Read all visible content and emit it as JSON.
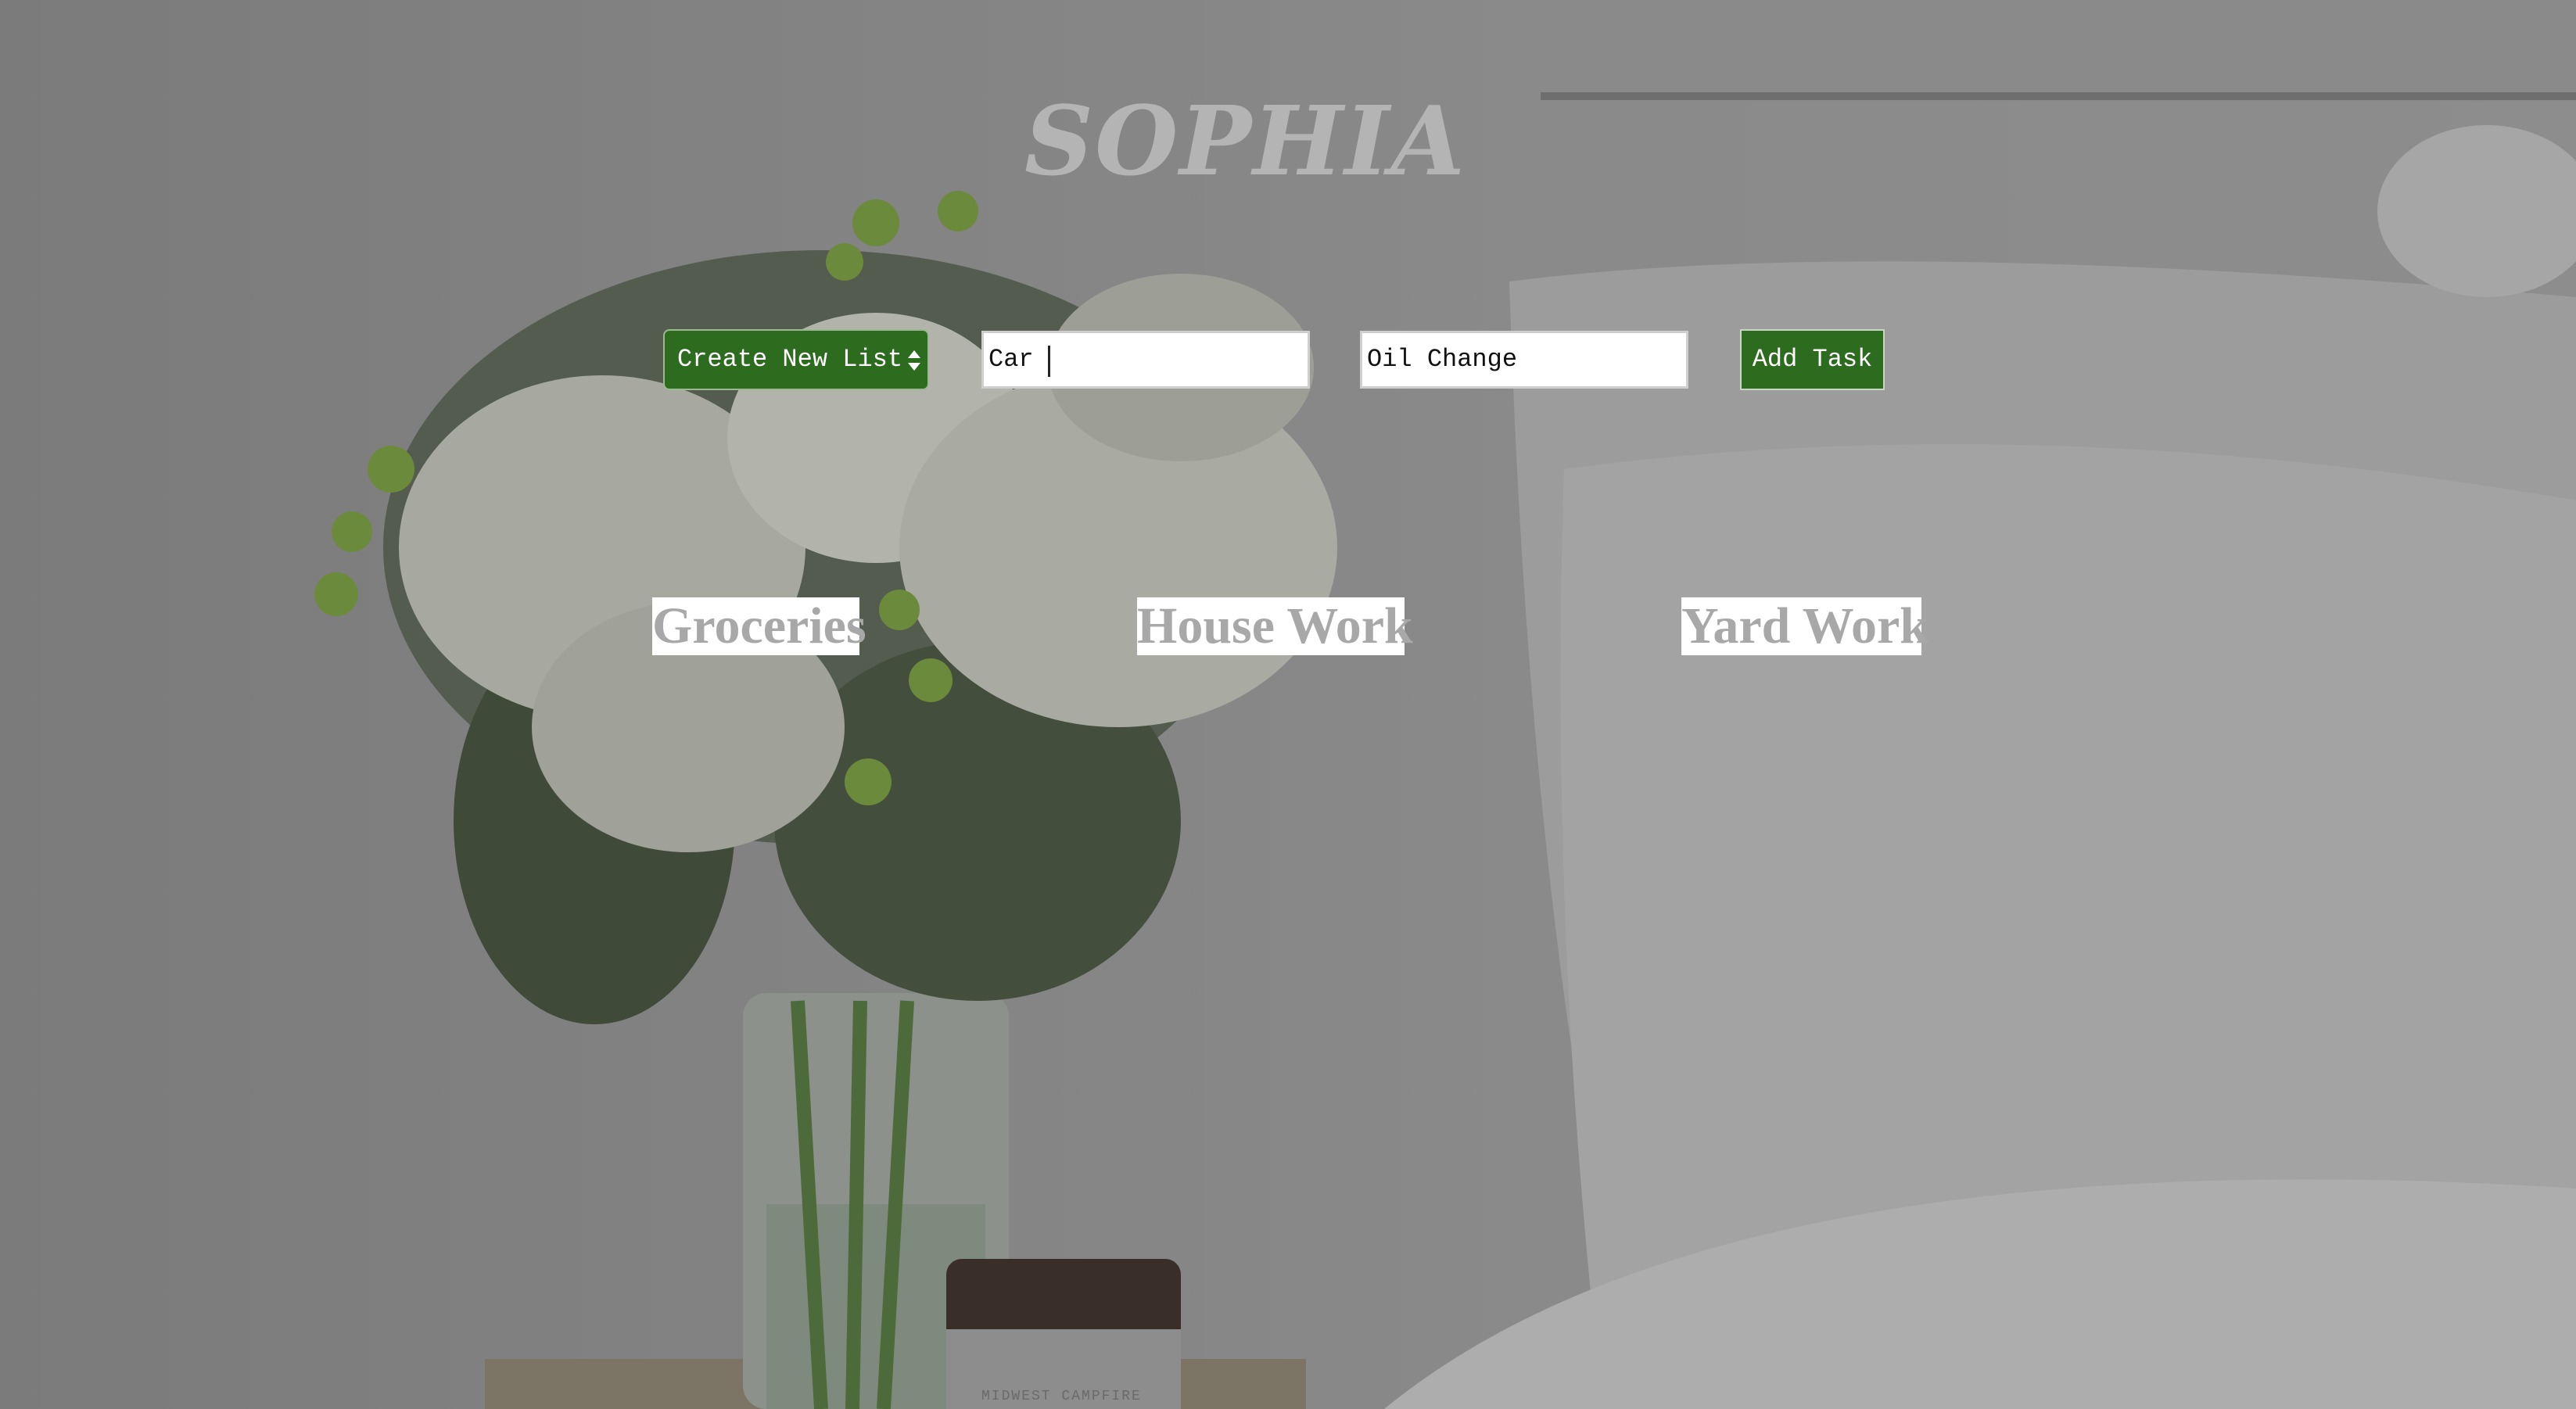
{
  "app": {
    "title": "SOPHIA"
  },
  "form": {
    "list_select": {
      "selected_label": "Create New List"
    },
    "list_name_input": {
      "value": "Car "
    },
    "task_input": {
      "value": "Oil Change"
    },
    "add_task_label": "Add Task"
  },
  "lists": [
    {
      "title": "Groceries"
    },
    {
      "title": "House Work"
    },
    {
      "title": "Yard Work"
    }
  ],
  "background": {
    "jar_label": "MIDWEST CAMPFIRE"
  },
  "colors": {
    "accent_green": "#2d6b1f",
    "title_gray": "#b4b4b4",
    "heading_gray": "#a8a8a8"
  }
}
